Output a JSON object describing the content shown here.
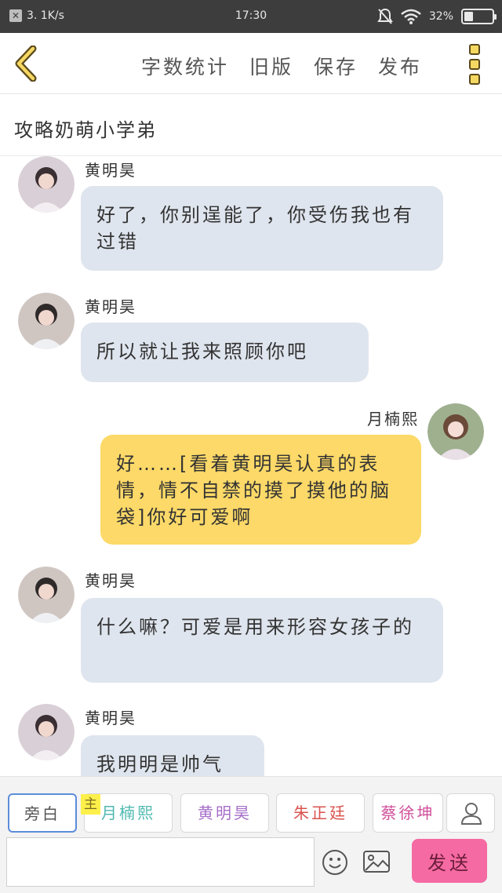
{
  "status_bar": {
    "speed": "3. 1K/s",
    "time": "17:30",
    "battery": "32%",
    "battery_level": 0.32
  },
  "toolbar": {
    "word_count": "字数统计",
    "old_version": "旧版",
    "save": "保存",
    "publish": "发布"
  },
  "story": {
    "title": "攻略奶萌小学弟"
  },
  "messages": [
    {
      "side": "left",
      "sender": "黄明昊",
      "text": "好了，你别逞能了，你受伤我也有过错"
    },
    {
      "side": "left",
      "sender": "黄明昊",
      "text": "所以就让我来照顾你吧"
    },
    {
      "side": "right",
      "sender": "月楠熙",
      "text": "好……[看着黄明昊认真的表情，情不自禁的摸了摸他的脑袋]你好可爱啊"
    },
    {
      "side": "left",
      "sender": "黄明昊",
      "text": "什么嘛？可爱是用来形容女孩子的"
    },
    {
      "side": "left",
      "sender": "黄明昊",
      "text": "我明明是帅气"
    }
  ],
  "roles": [
    {
      "label": "旁白",
      "color": "#555555"
    },
    {
      "label": "月楠熙",
      "color": "#4fb8b0"
    },
    {
      "label": "黄明昊",
      "color": "#a66fc9"
    },
    {
      "label": "朱正廷",
      "color": "#d9534f"
    },
    {
      "label": "蔡徐坤",
      "color": "#d0509a"
    }
  ],
  "main_tag": "主",
  "composer": {
    "input_value": "",
    "placeholder": "",
    "send_label": "发送"
  }
}
